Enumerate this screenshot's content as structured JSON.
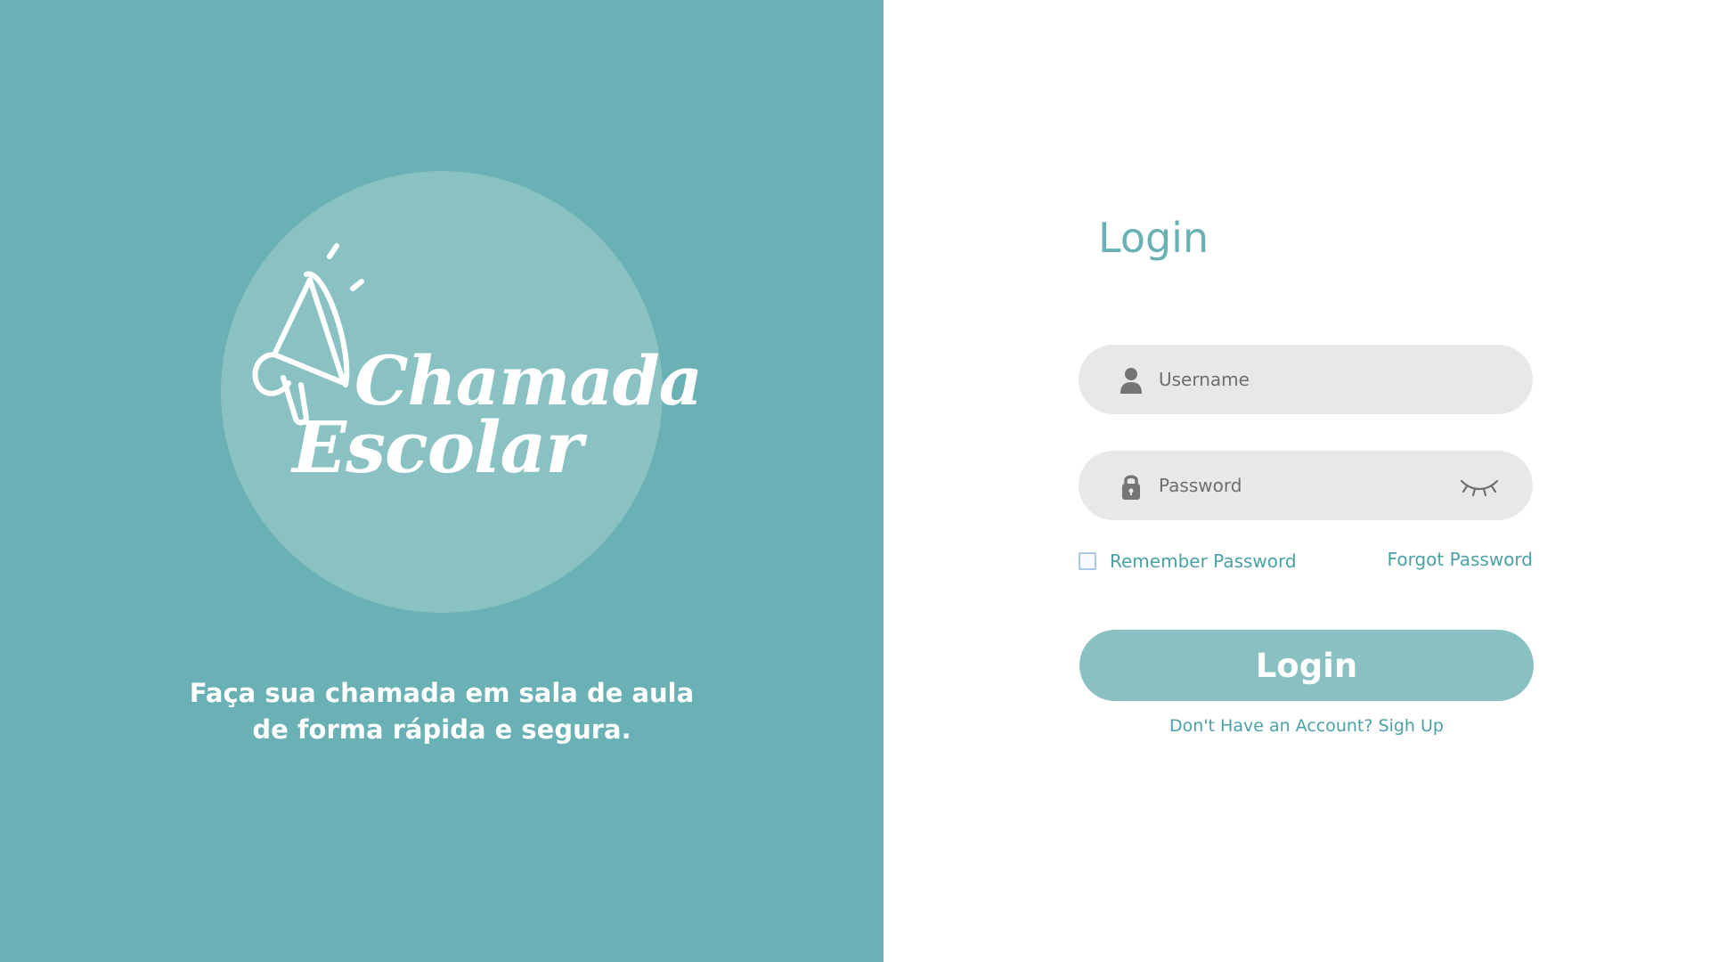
{
  "brand": {
    "logo_line1": "Chamada",
    "logo_line2": "Escolar",
    "tagline_line1": "Faça sua chamada em sala de aula",
    "tagline_line2": "de forma rápida e segura."
  },
  "login": {
    "title": "Login",
    "username_placeholder": "Username",
    "password_placeholder": "Password",
    "remember_label": "Remember Password",
    "remember_checked": false,
    "forgot_label": "Forgot Password",
    "submit_label": "Login",
    "signup_label": "Don't Have an Account? Sigh Up"
  },
  "icons": {
    "logo": "megaphone-icon",
    "username": "user-icon",
    "password": "lock-icon",
    "toggle": "eye-closed-icon"
  },
  "colors": {
    "left_panel": "#69b1b4",
    "logo_circle": "#8ac1c3",
    "accent_text": "#4aa1a6",
    "button": "#89c1c3",
    "field_bg": "#e8e8e8"
  }
}
